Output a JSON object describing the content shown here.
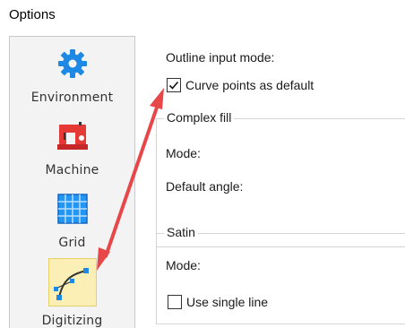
{
  "window": {
    "title": "Options"
  },
  "sidebar": {
    "items": [
      {
        "label": "Environment",
        "icon": "gear-icon",
        "color": "#1e88e5"
      },
      {
        "label": "Machine",
        "icon": "sewing-machine-icon",
        "color": "#e53935"
      },
      {
        "label": "Grid",
        "icon": "grid-icon",
        "color": "#1e88e5"
      },
      {
        "label": "Digitizing",
        "icon": "bezier-curve-icon",
        "color": "#1e88e5",
        "selected": true
      }
    ]
  },
  "main": {
    "outline_label": "Outline input mode:",
    "curve_points": {
      "label": "Curve points as default",
      "checked": true
    },
    "complex_fill": {
      "title": "Complex fill",
      "mode_label": "Mode:",
      "angle_label": "Default angle:"
    },
    "satin": {
      "title": "Satin",
      "mode_label": "Mode:",
      "single_line": {
        "label": "Use single line",
        "checked": false
      }
    }
  },
  "annotation": {
    "color": "#e8474a"
  }
}
